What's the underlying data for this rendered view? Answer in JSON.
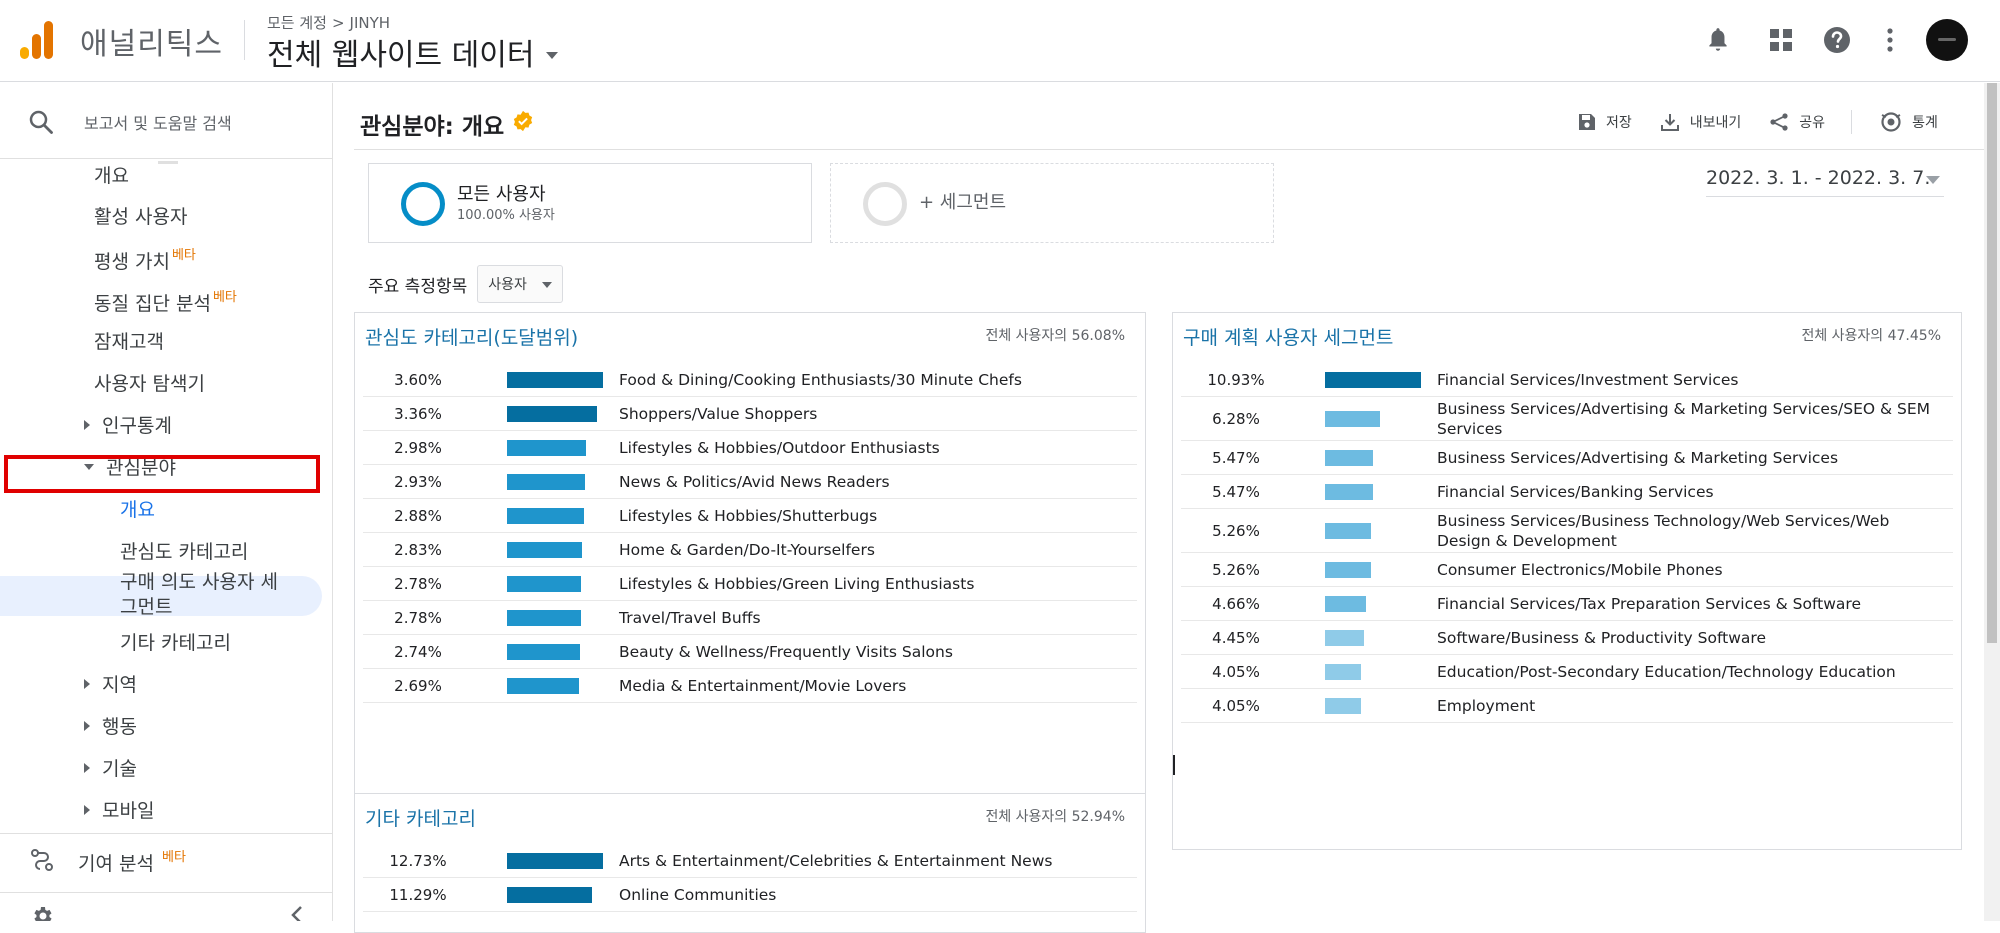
{
  "header": {
    "app_name": "애널리틱스",
    "breadcrumb": {
      "account_all": "모든 계정",
      "arrow": ">",
      "account": "JINYH"
    },
    "property_view": "전체 웹사이트 데이터"
  },
  "sidebar": {
    "search_placeholder": "보고서 및 도움말 검색",
    "items": [
      {
        "label": "개요",
        "level": 1
      },
      {
        "label": "활성 사용자",
        "level": 1
      },
      {
        "label": "평생 가치",
        "level": 1,
        "badge": "베타"
      },
      {
        "label": "동질 집단 분석",
        "level": 1,
        "badge": "베타"
      },
      {
        "label": "잠재고객",
        "level": 1
      },
      {
        "label": "사용자 탐색기",
        "level": 1
      }
    ],
    "groups": {
      "demographics": "인구통계",
      "interests": "관심분야",
      "geo": "지역",
      "behavior": "행동",
      "technology": "기술",
      "mobile": "모바일"
    },
    "interest_children": {
      "overview": "개요",
      "affinity": "관심도 카테고리",
      "in_market_1": "구매 의도 사용자 세",
      "in_market_2": "그먼트",
      "other": "기타 카테고리"
    },
    "attribution": "기여 분석",
    "attribution_badge": "베타"
  },
  "page": {
    "title": "관심분야: 개요",
    "actions": {
      "save": "저장",
      "export": "내보내기",
      "share": "공유",
      "insights": "통계"
    },
    "segments": {
      "all_users_label": "모든 사용자",
      "all_users_sub": "100.00% 사용자",
      "add_segment": "+ 세그먼트"
    },
    "date_range": "2022. 3. 1. - 2022. 3. 7.",
    "metric_label": "주요 측정항목",
    "metric_value": "사용자"
  },
  "cards": {
    "affinity": {
      "title": "관심도 카테고리(도달범위)",
      "share": "전체 사용자의 56.08%",
      "rows": [
        {
          "pct": "3.60%",
          "value": 3.6,
          "name": "Food & Dining/Cooking Enthusiasts/30 Minute Chefs"
        },
        {
          "pct": "3.36%",
          "value": 3.36,
          "name": "Shoppers/Value Shoppers"
        },
        {
          "pct": "2.98%",
          "value": 2.98,
          "name": "Lifestyles & Hobbies/Outdoor Enthusiasts"
        },
        {
          "pct": "2.93%",
          "value": 2.93,
          "name": "News & Politics/Avid News Readers"
        },
        {
          "pct": "2.88%",
          "value": 2.88,
          "name": "Lifestyles & Hobbies/Shutterbugs"
        },
        {
          "pct": "2.83%",
          "value": 2.83,
          "name": "Home & Garden/Do-It-Yourselfers"
        },
        {
          "pct": "2.78%",
          "value": 2.78,
          "name": "Lifestyles & Hobbies/Green Living Enthusiasts"
        },
        {
          "pct": "2.78%",
          "value": 2.78,
          "name": "Travel/Travel Buffs"
        },
        {
          "pct": "2.74%",
          "value": 2.74,
          "name": "Beauty & Wellness/Frequently Visits Salons"
        },
        {
          "pct": "2.69%",
          "value": 2.69,
          "name": "Media & Entertainment/Movie Lovers"
        }
      ]
    },
    "in_market": {
      "title": "구매 계획 사용자 세그먼트",
      "share": "전체 사용자의 47.45%",
      "rows": [
        {
          "pct": "10.93%",
          "value": 10.93,
          "name": "Financial Services/Investment Services"
        },
        {
          "pct": "6.28%",
          "value": 6.28,
          "name": "Business Services/Advertising & Marketing Services/SEO & SEM Services"
        },
        {
          "pct": "5.47%",
          "value": 5.47,
          "name": "Business Services/Advertising & Marketing Services"
        },
        {
          "pct": "5.47%",
          "value": 5.47,
          "name": "Financial Services/Banking Services"
        },
        {
          "pct": "5.26%",
          "value": 5.26,
          "name": "Business Services/Business Technology/Web Services/Web Design & Development"
        },
        {
          "pct": "5.26%",
          "value": 5.26,
          "name": "Consumer Electronics/Mobile Phones"
        },
        {
          "pct": "4.66%",
          "value": 4.66,
          "name": "Financial Services/Tax Preparation Services & Software"
        },
        {
          "pct": "4.45%",
          "value": 4.45,
          "name": "Software/Business & Productivity Software"
        },
        {
          "pct": "4.05%",
          "value": 4.05,
          "name": "Education/Post-Secondary Education/Technology Education"
        },
        {
          "pct": "4.05%",
          "value": 4.05,
          "name": "Employment"
        }
      ]
    },
    "other": {
      "title": "기타 카테고리",
      "share": "전체 사용자의 52.94%",
      "rows": [
        {
          "pct": "12.73%",
          "value": 12.73,
          "name": "Arts & Entertainment/Celebrities & Entertainment News"
        },
        {
          "pct": "11.29%",
          "value": 11.29,
          "name": "Online Communities"
        }
      ]
    }
  },
  "colors": {
    "bar_dark": "#056ea0",
    "bar_mid": "#1f95cc",
    "bar_light": "#6dbbe1",
    "bar_lighter": "#8fcbe8",
    "brand_orange": "#e37400",
    "highlight_red": "#e00000"
  }
}
